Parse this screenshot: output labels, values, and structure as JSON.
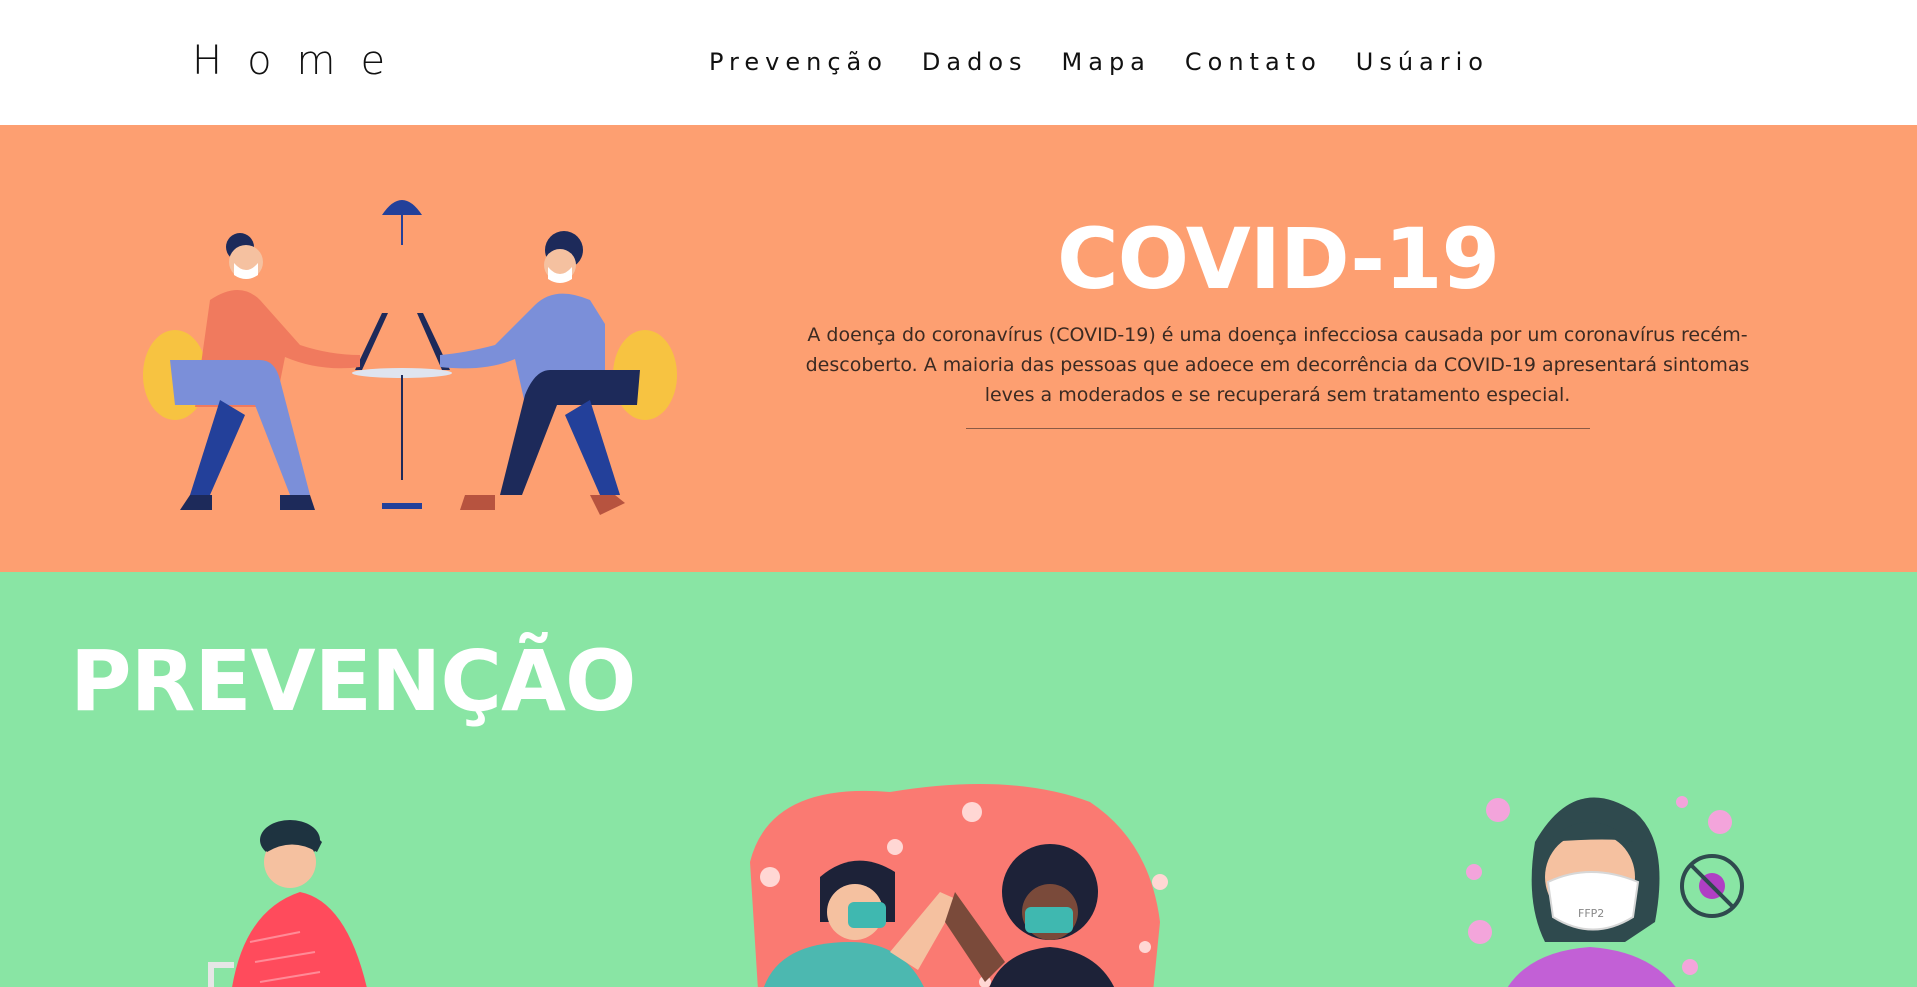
{
  "navbar": {
    "brand": "Home",
    "links": [
      "Prevenção",
      "Dados",
      "Mapa",
      "Contato",
      "Usúario"
    ]
  },
  "hero": {
    "title": "COVID-19",
    "text": "A doença do coronavírus (COVID-19) é uma doença infecciosa causada por um coronavírus recém-descoberto. A maioria das pessoas que adoece em decorrência da COVID-19 apresentará sintomas leves a moderados e se recuperará sem tratamento especial."
  },
  "prevention": {
    "title": "PREVENÇÃO",
    "mask_label": "FFP2"
  },
  "colors": {
    "hero_bg": "#fd9f71",
    "prevention_bg": "#89e5a4"
  }
}
